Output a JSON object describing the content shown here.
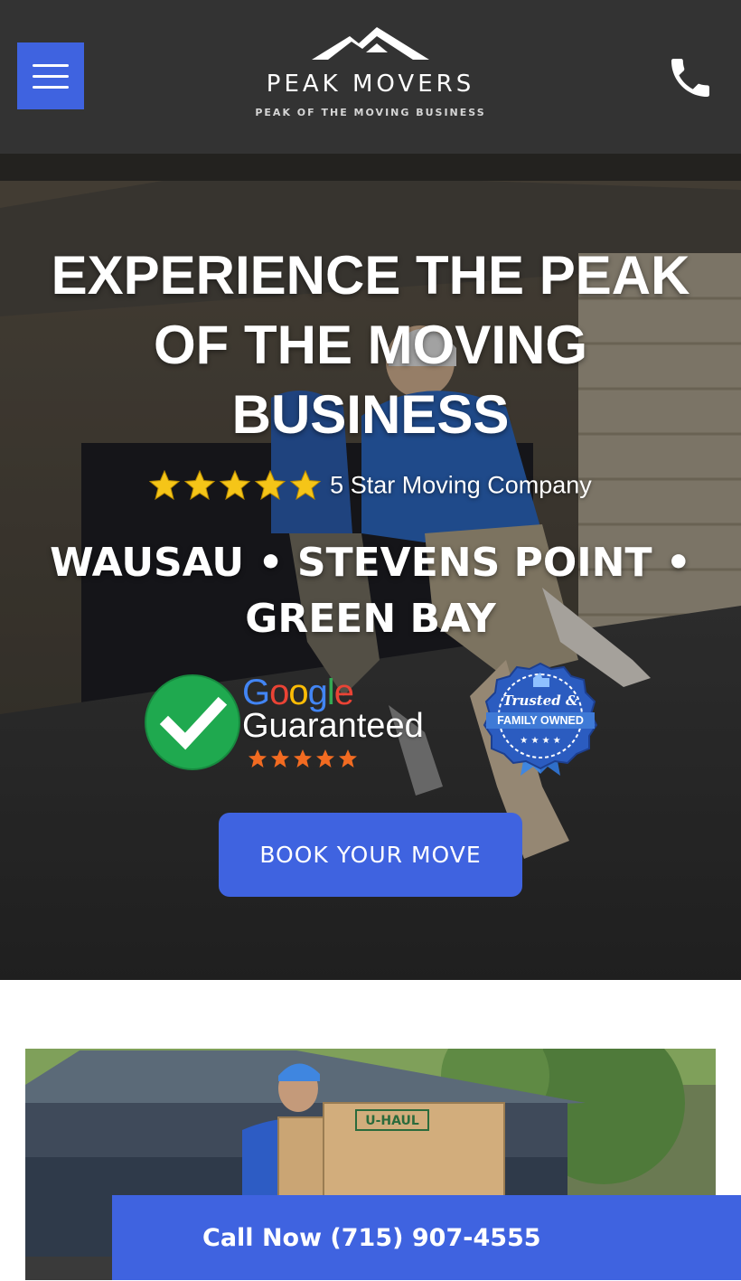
{
  "header": {
    "brand_name": "PEAK MOVERS",
    "tagline": "PEAK OF THE MOVING BUSINESS",
    "menu_icon": "hamburger-menu-icon",
    "phone_icon": "phone-icon",
    "background": "#333333"
  },
  "hero": {
    "title": "EXPERIENCE THE PEAK OF THE MOVING BUSINESS",
    "rating_stars": 5,
    "rating_text": "5 Star Moving Company",
    "locations": "WAUSAU • STEVENS POINT • GREEN BAY",
    "google_badge": {
      "word": [
        "G",
        "o",
        "o",
        "g",
        "l",
        "e"
      ],
      "guaranteed": "Guaranteed",
      "stars": 5
    },
    "trusted_badge": {
      "line1": "Trusted &",
      "line2": "FAMILY OWNED"
    },
    "cta_label": "BOOK YOUR MOVE"
  },
  "call_bar": {
    "label": "Call Now (715) 907-4555"
  },
  "colors": {
    "accent": "#3f63e0",
    "header_bg": "#333333",
    "star_gold": "#f5c518",
    "google_stars": "#f26b21"
  }
}
